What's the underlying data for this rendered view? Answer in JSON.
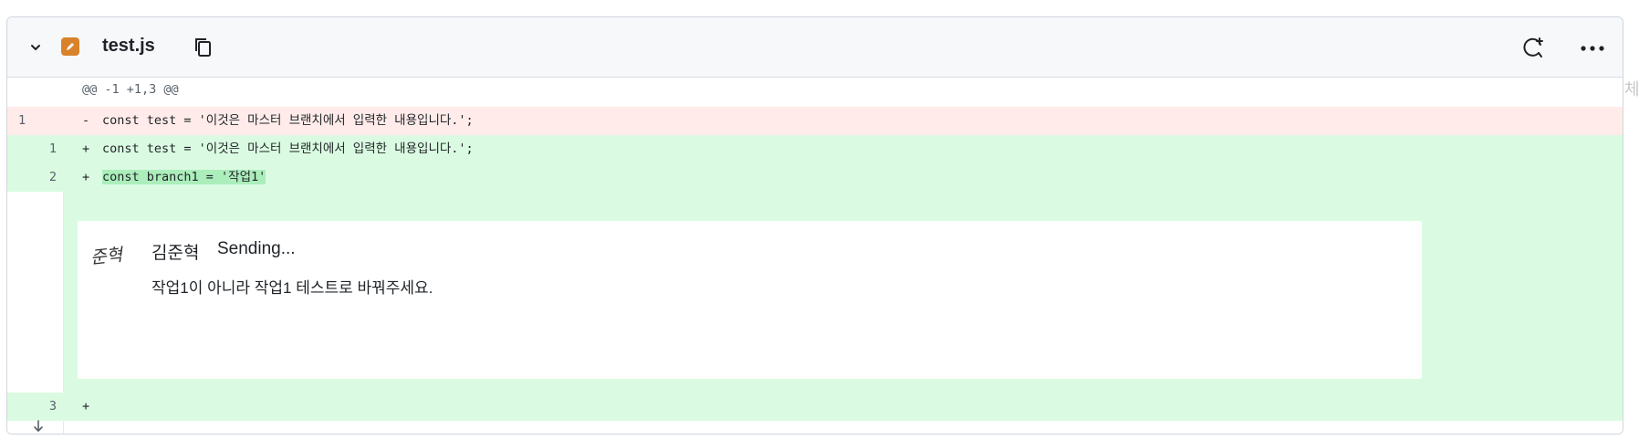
{
  "file_header": {
    "filename": "test.js",
    "icons": {
      "collapse": "chevron-down-icon",
      "file_type": "modified-file-icon",
      "copy": "copy-icon",
      "add_comment": "add-comment-icon",
      "more": "more-horizontal-icon",
      "expand": "expand-down-icon"
    },
    "file_badge_color": "#d9822b"
  },
  "diff": {
    "hunk_header": "@@ -1 +1,3 @@",
    "lines": [
      {
        "type": "deletion",
        "old_num": "1",
        "new_num": "",
        "sign": "-",
        "code": "const test = '이것은 마스터 브랜치에서 입력한 내용입니다.';"
      },
      {
        "type": "addition",
        "old_num": "",
        "new_num": "1",
        "sign": "+",
        "code": "const test = '이것은 마스터 브랜치에서 입력한 내용입니다.';"
      },
      {
        "type": "addition",
        "old_num": "",
        "new_num": "2",
        "sign": "+",
        "code": "const branch1 = '작업1'"
      },
      {
        "type": "addition",
        "old_num": "",
        "new_num": "3",
        "sign": "+",
        "code": ""
      }
    ],
    "colors": {
      "deletion_bg": "#ffebe9",
      "addition_bg": "#dafbe1",
      "highlight": "#aceebb"
    }
  },
  "comment": {
    "author": "김준혁",
    "status": "Sending...",
    "body": "작업1이 아니라 작업1 테스트로 바꿔주세요.",
    "avatar_signature": "준혁"
  },
  "edge_text": "체"
}
